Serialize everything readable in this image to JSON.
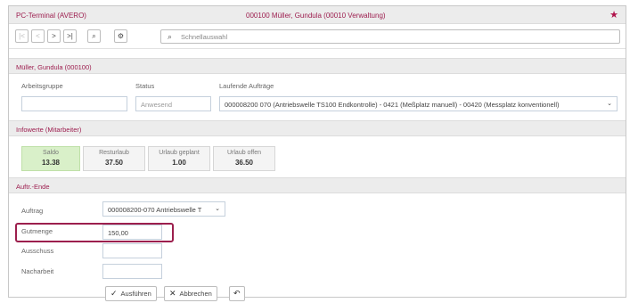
{
  "title_bar": {
    "app_title": "PC-Terminal (AVERO)",
    "record_title": "000100  Müller, Gundula  (00010 Verwaltung)",
    "pin_glyph": "★"
  },
  "toolbar": {
    "first_glyph": "|<",
    "prev_glyph": "<",
    "next_glyph": ">",
    "last_glyph": ">|",
    "search_glyph": "⌕",
    "settings_glyph": "⚙",
    "quick_search_placeholder": "Schnellauswahl"
  },
  "employee": {
    "header": "Müller, Gundula (000100)",
    "group_label": "Arbeitsgruppe",
    "group_value": "",
    "status_label": "Status",
    "status_value": "Anwesend",
    "orders_label": "Laufende Aufträge",
    "orders_value": "000008200 070 (Antriebswelle TS100 Endkontrolle) - 0421 (Meßplatz manuell) - 00420 (Messplatz konventionell)",
    "dropdown_glyph": "⌄"
  },
  "info": {
    "header": "Infowerte (Mitarbeiter)",
    "cards": [
      {
        "title": "Saldo",
        "value": "13.38"
      },
      {
        "title": "Resturlaub",
        "value": "37.50"
      },
      {
        "title": "Urlaub geplant",
        "value": "1.00"
      },
      {
        "title": "Urlaub offen",
        "value": "36.50"
      }
    ]
  },
  "order_end": {
    "header": "Auftr.-Ende",
    "order_label": "Auftrag",
    "order_value": "000008200-070 Antriebswelle T",
    "good_qty_label": "Gutmenge",
    "good_qty_value": "150,00",
    "scrap_label": "Ausschuss",
    "scrap_value": "",
    "rework_label": "Nacharbeit",
    "rework_value": "",
    "execute_label": "Ausführen",
    "execute_glyph": "✓",
    "cancel_label": "Abbrechen",
    "cancel_glyph": "✕",
    "undo_glyph": "↶"
  },
  "colors": {
    "accent": "#9d1e4f",
    "saldo_card": "#d9f0c9",
    "header_bg": "#ececec"
  }
}
